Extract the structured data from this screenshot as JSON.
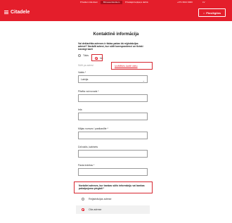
{
  "topbar": {
    "nav": [
      "Privātiem klientiem",
      "Biznesa klientiem",
      "Privātajā baņķieŗa darbā"
    ],
    "phone": "+371 6010 0000",
    "language": "LV"
  },
  "header": {
    "brand": "Citadele",
    "login_label": "Pieslēgties"
  },
  "form": {
    "title": "Kontaktinē informācija",
    "question": "Vai deklarētās adreses ir tādas pašas kā reģistrācijas adresē? Norādīt adresi, kur sūtīt korespondenci un fiziski izsniegt karti",
    "yes_label": "Tāds",
    "no_label": "Nē",
    "mailing_label": "Sūtīt pa adresi",
    "map_link": "Izvēlēties kartē vietu",
    "country_label": "Valsts *",
    "country_value": "Latvija",
    "city_label": "Pilsēta vai novads *",
    "street_label": "Iela",
    "house_label": "Mājas numurs / pastkastīte *",
    "apartment_label": "Dzīvoklis, kabinets",
    "postal_label": "Pasta indekss *",
    "note": "Norādiet adreses, kur bankas sūtīs informāciju vai bankas pakalpojumu piegādi *",
    "option_registration": "Reģistrācijas adrese",
    "option_other": "Cita adrese"
  }
}
